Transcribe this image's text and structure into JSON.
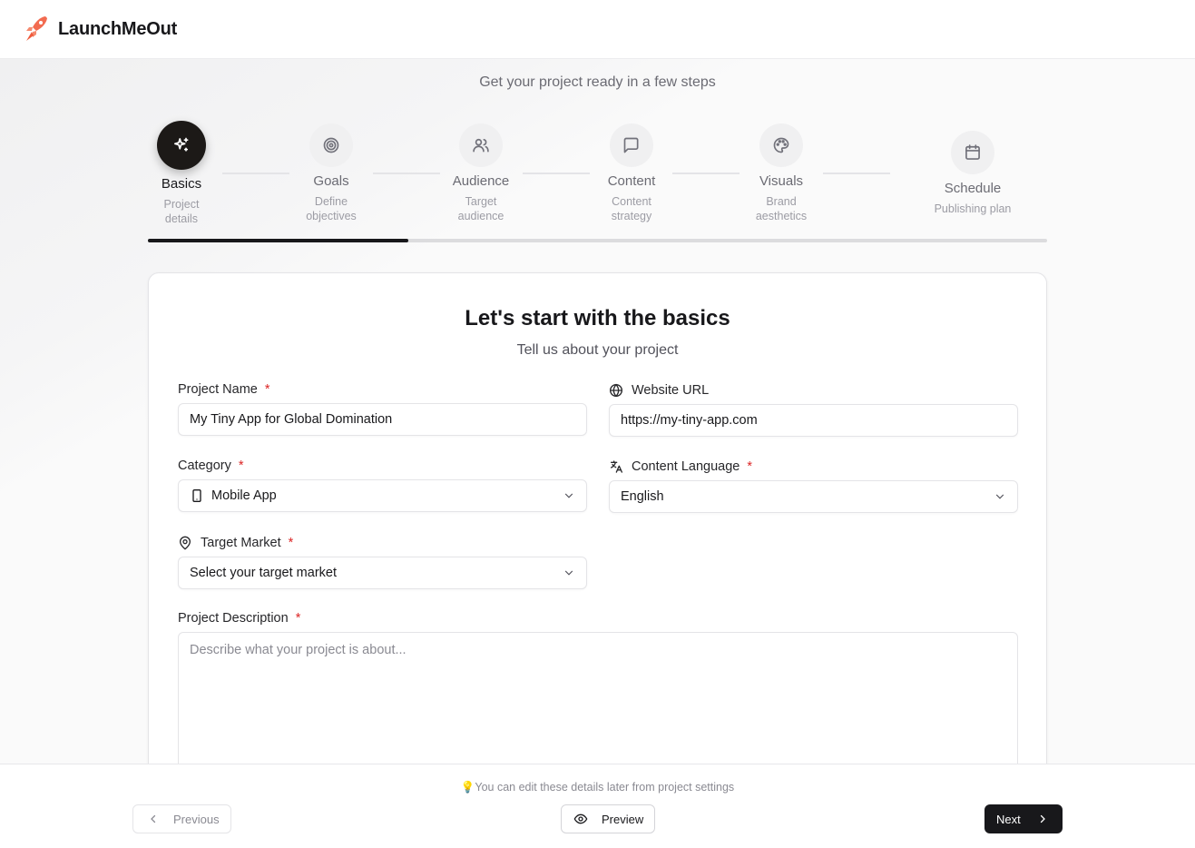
{
  "app": {
    "brand": "LaunchMeOut"
  },
  "wizard": {
    "subtitle": "Get your project ready in a few steps",
    "progress_percent": 29
  },
  "steps": [
    {
      "label": "Basics",
      "desc": "Project details",
      "icon": "sparkles-icon",
      "active": true
    },
    {
      "label": "Goals",
      "desc": "Define objectives",
      "icon": "target-icon"
    },
    {
      "label": "Audience",
      "desc": "Target audience",
      "icon": "users-icon"
    },
    {
      "label": "Content",
      "desc": "Content strategy",
      "icon": "message-square-icon"
    },
    {
      "label": "Visuals",
      "desc": "Brand aesthetics",
      "icon": "palette-icon"
    },
    {
      "label": "Schedule",
      "desc": "Publishing plan",
      "icon": "calendar-icon"
    }
  ],
  "form": {
    "title": "Let's start with the basics",
    "subtitle": "Tell us about your project",
    "project_name": {
      "label": "Project Name",
      "required": "*",
      "value": "My Tiny App for Global Domination"
    },
    "website_url": {
      "label": "Website URL",
      "value": "https://my-tiny-app.com",
      "icon": "globe-icon"
    },
    "category": {
      "label": "Category",
      "required": "*",
      "value": "Mobile App",
      "icon": "smartphone-icon"
    },
    "content_language": {
      "label": "Content Language",
      "required": "*",
      "value": "English",
      "icon": "languages-icon"
    },
    "target_market": {
      "label": "Target Market",
      "required": "*",
      "value": "Select your target market",
      "icon": "map-pin-icon"
    },
    "project_description": {
      "label": "Project Description",
      "required": "*",
      "placeholder": "Describe what your project is about..."
    }
  },
  "footer": {
    "tip": "💡You can edit these details later from project settings",
    "previous_label": "Previous",
    "preview_label": "Preview",
    "next_label": "Next"
  }
}
